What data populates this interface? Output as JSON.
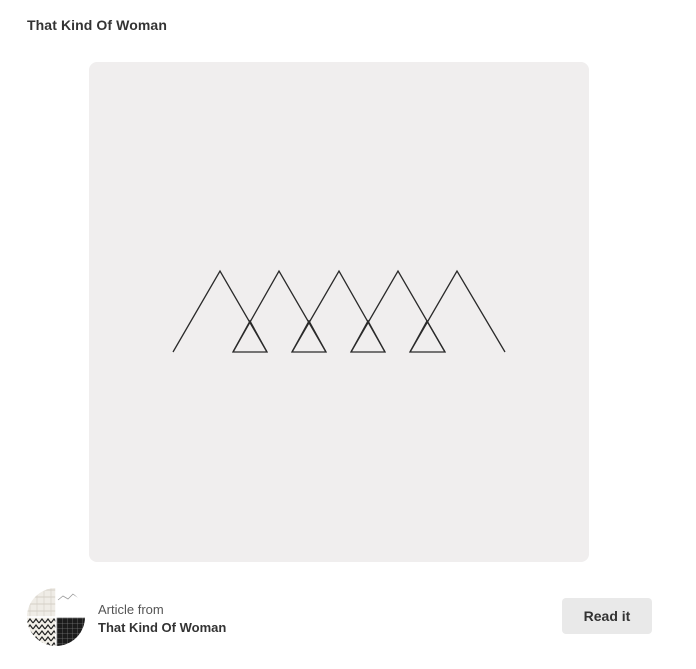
{
  "header": {
    "title": "That Kind Of Woman"
  },
  "pin": {
    "image_icon": "triangle-pattern-artwork",
    "background_color": "#f0eeee"
  },
  "footer": {
    "avatar_icon": "board-collage-avatar",
    "source_prefix": "Article from",
    "source_name": "That Kind Of Woman",
    "read_button_label": "Read it"
  }
}
